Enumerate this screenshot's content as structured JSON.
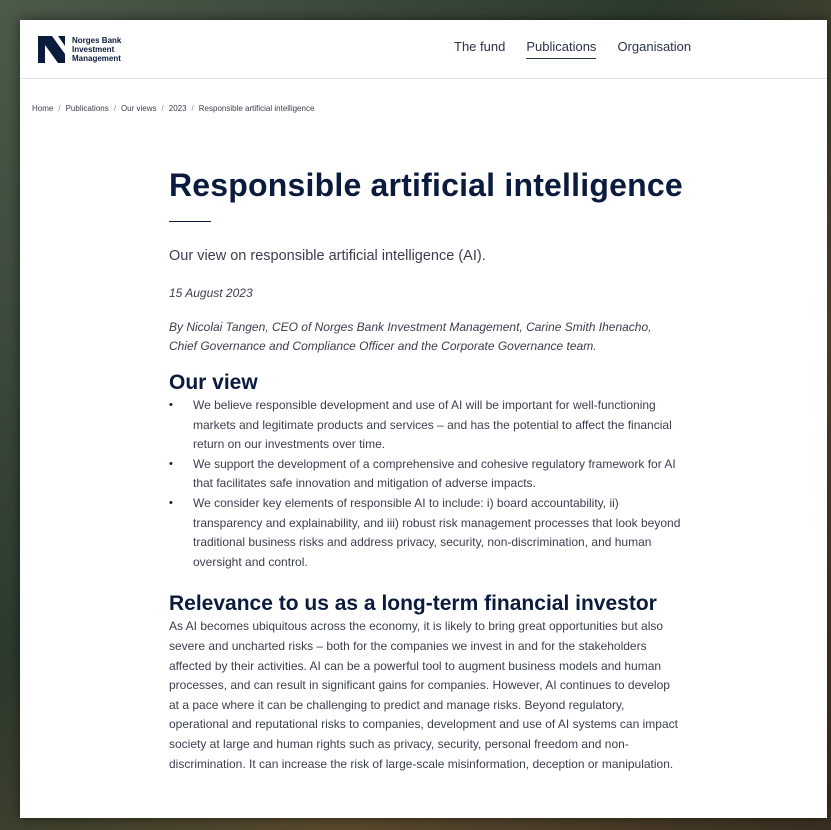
{
  "brand": {
    "logo_lines": [
      "Norges Bank",
      "Investment",
      "Management"
    ],
    "color": "#0b1b3d"
  },
  "nav": {
    "items": [
      {
        "label": "The fund",
        "active": false
      },
      {
        "label": "Publications",
        "active": true
      },
      {
        "label": "Organisation",
        "active": false
      }
    ]
  },
  "breadcrumb": [
    "Home",
    "Publications",
    "Our views",
    "2023",
    "Responsible artificial intelligence"
  ],
  "breadcrumb_separator": "/",
  "article": {
    "title": "Responsible artificial intelligence",
    "lead": "Our view on responsible artificial intelligence (AI).",
    "date": "15 August 2023",
    "byline": "By Nicolai Tangen, CEO of Norges Bank Investment Management, Carine Smith Ihenacho, Chief Governance and Compliance Officer and the Corporate Governance team.",
    "sections": [
      {
        "heading": "Our view",
        "bullets": [
          "We believe responsible development and use of AI will be important for well-functioning markets and legitimate products and services – and has the potential to affect the financial return on our investments over time.",
          "We support the development of a comprehensive and cohesive regulatory framework for AI that facilitates safe innovation and mitigation of adverse impacts.",
          "We consider key elements of responsible AI to include: i) board accountability, ii) transparency and explainability, and iii) robust risk management processes that look beyond traditional business risks and address privacy, security, non-discrimination, and human oversight and control."
        ]
      },
      {
        "heading": "Relevance to us as a long-term financial investor",
        "paragraph": "As AI becomes ubiquitous across the economy, it is likely to bring great opportunities but also severe and uncharted risks – both for the companies we invest in and for the stakeholders affected by their activities. AI can be a powerful tool to augment business models and human processes, and can result in significant gains for companies. However, AI continues to develop at a pace where it can be challenging to predict and manage risks. Beyond regulatory, operational and reputational risks to companies, development and use of AI systems can impact society at large and human rights such as privacy, security, personal freedom and non-discrimination. It can increase the risk of large-scale misinformation, deception or manipulation."
      }
    ]
  }
}
